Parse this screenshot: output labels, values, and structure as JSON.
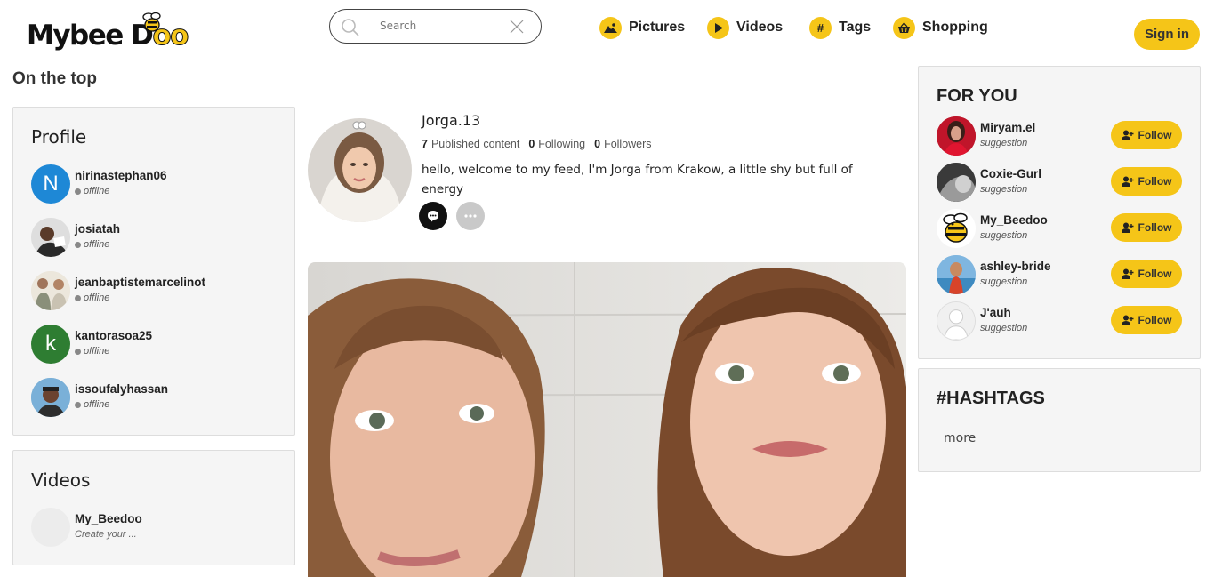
{
  "header": {
    "logo_text": "MybeeDoo",
    "search": {
      "placeholder": "Search"
    },
    "nav": [
      {
        "label": "Pictures",
        "icon": "mountain-icon"
      },
      {
        "label": "Videos",
        "icon": "play-icon"
      },
      {
        "label": "Tags",
        "icon": "hashtag-icon"
      },
      {
        "label": "Shopping",
        "icon": "basket-icon"
      }
    ],
    "signin_label": "Sign in"
  },
  "left": {
    "section_title": "On the top",
    "profile_panel": {
      "title": "Profile",
      "users": [
        {
          "name": "nirinastephan06",
          "status": "offline",
          "initial": "N",
          "color": "#1e88d6"
        },
        {
          "name": "josiatah",
          "status": "offline"
        },
        {
          "name": "jeanbaptistemarcelinot",
          "status": "offline"
        },
        {
          "name": "kantorasoa25",
          "status": "offline",
          "initial": "k",
          "color": "#2e7d32"
        },
        {
          "name": "issoufalyhassan",
          "status": "offline"
        }
      ]
    },
    "videos_panel": {
      "title": "Videos",
      "items": [
        {
          "name": "My_Beedoo",
          "subtitle": "Create your ..."
        }
      ]
    }
  },
  "profile": {
    "name": "Jorga.13",
    "stats": [
      {
        "value": "7",
        "label": "Published content"
      },
      {
        "value": "0",
        "label": "Following"
      },
      {
        "value": "0",
        "label": "Followers"
      }
    ],
    "bio": "hello, welcome to my feed, I'm Jorga from Krakow, a little shy but full of energy"
  },
  "right": {
    "for_you": {
      "title": "FOR YOU",
      "follow_label": "Follow",
      "suggestions": [
        {
          "name": "Miryam.el",
          "subtitle": "suggestion"
        },
        {
          "name": "Coxie-Gurl",
          "subtitle": "suggestion"
        },
        {
          "name": "My_Beedoo",
          "subtitle": "suggestion"
        },
        {
          "name": "ashley-bride",
          "subtitle": "suggestion"
        },
        {
          "name": "J'auh",
          "subtitle": "suggestion"
        }
      ]
    },
    "hashtags": {
      "title": "#HASHTAGS",
      "more_label": "more"
    }
  },
  "colors": {
    "accent": "#f5c518",
    "panel_bg": "#f5f5f5"
  }
}
